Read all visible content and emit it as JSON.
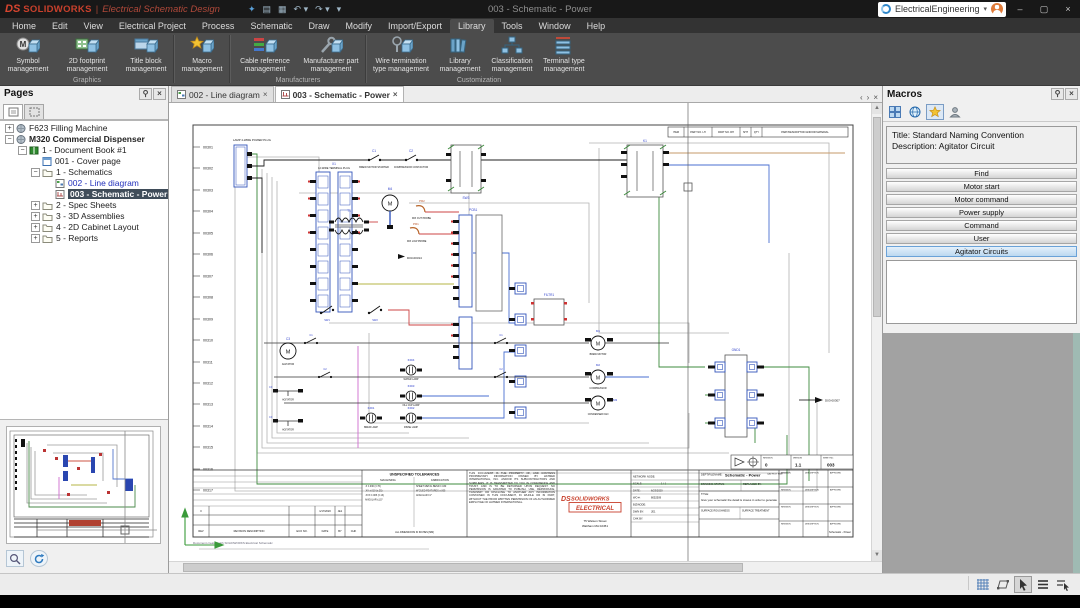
{
  "ui": {
    "close": "×",
    "pin": "⚲",
    "caret": "▾",
    "prev": "‹",
    "next": "›",
    "minimize": "–",
    "maximize": "▢",
    "collapsed": "+",
    "expanded": "−"
  },
  "titlebar": {
    "logo_ds": "DS",
    "brand": "SOLIDWORKS",
    "divider": "|",
    "app_title": "Electrical Schematic Design",
    "doc_title": "003 - Schematic - Power",
    "account": "ElectricalEngineering"
  },
  "menubar": {
    "items": [
      "Home",
      "Edit",
      "View",
      "Electrical Project",
      "Process",
      "Schematic",
      "Draw",
      "Modify",
      "Import/Export",
      "Library",
      "Tools",
      "Window",
      "Help"
    ]
  },
  "ribbon": {
    "groups": [
      {
        "label": "Graphics",
        "items": [
          "Symbol management",
          "2D footprint management",
          "Title block management"
        ]
      },
      {
        "label": "",
        "items": [
          "Macro management"
        ]
      },
      {
        "label": "Manufacturers",
        "items": [
          "Cable reference management",
          "Manufacturer part management"
        ]
      },
      {
        "label": "Customization",
        "items": [
          "Wire termination type management",
          "Library management",
          "Classification management",
          "Terminal type management"
        ]
      }
    ]
  },
  "pages_panel": {
    "title": "Pages",
    "tree": [
      {
        "label": "F623 Filling Machine"
      },
      {
        "label": "M320 Commercial Dispenser"
      },
      {
        "label": "1 - Document Book #1"
      },
      {
        "label": "001 - Cover page"
      },
      {
        "label": "1 - Schematics"
      },
      {
        "label": "002 - Line diagram"
      },
      {
        "label": "003 - Schematic - Power"
      },
      {
        "label": "2 - Spec Sheets"
      },
      {
        "label": "3 - 3D Assemblies"
      },
      {
        "label": "4 - 2D Cabinet Layout"
      },
      {
        "label": "5 - Reports"
      }
    ]
  },
  "doc_tabs": {
    "tabs": [
      "002 - Line diagram",
      "003 - Schematic - Power"
    ]
  },
  "macros_panel": {
    "title": "Macros",
    "info_line1": "Title: Standard Naming Convention",
    "info_line2": "Description: Agitator Circuit",
    "groups": [
      "Find",
      "Motor start",
      "Motor command",
      "Power supply",
      "Command",
      "User",
      "Agitator Circuits"
    ]
  },
  "schematic": {
    "wire_numbers": [
      "00301",
      "00302",
      "00303",
      "00304",
      "00305",
      "00306",
      "00307",
      "00308",
      "00309",
      "00310",
      "00311",
      "00312",
      "00313",
      "00314",
      "00315",
      "00316",
      "00317"
    ],
    "bom_columns": [
      "ITEM",
      "PART NO. LH",
      "PART NO. RH",
      "SHT",
      "QTY",
      "PART/DESCRIPTION AND/OR MATERIAL"
    ],
    "components": {
      "j1_desc": "LAMP 4-WIRE POWER PLUG",
      "x1_label": "X1",
      "x1_desc": "12-WIRE TERMINAL PLUG",
      "c1_label": "C1",
      "c1_desc": "BREW MOTOR STARTER",
      "c2_label": "C2",
      "c2_desc": "COMPRESSOR CONTACTOR",
      "sw1_label": "SW1",
      "sw1_desc": "SWITCH",
      "sw2_label": "SW2",
      "sw2_desc": "SWITCH",
      "sw3_label": "SW3",
      "k1_label": "K1",
      "t1_label": "T1",
      "m4_label": "M4",
      "m1_label": "M1",
      "m1_desc": "BREW MOTOR",
      "m2_label": "M2",
      "m2_desc": "COMPRESSOR",
      "m3_label": "M3",
      "m3_desc": "CONDENSER FAN",
      "c3_label": "C3",
      "c3_desc": "AGITATOR",
      "pr1_label": "PR1",
      "pr1_desc": "MIX LOW PROBE",
      "pr2_label": "PR2",
      "pr2_desc": "MIX OUT PROBE",
      "pcb1_label": "PCB1",
      "filtr1_label": "FILTR1",
      "gnd1_label": "GND1",
      "ind1_label": "IND1",
      "ind1_desc": "BREW LAMP",
      "ind2_label": "IND2",
      "ind2_desc": "RINSE LAMP",
      "ind3_label": "IND3",
      "ind3_desc": "FILL CUP LAMP",
      "ind4_label": "IND4",
      "ind4_desc": "WATER LAMP",
      "motor_letter": "M",
      "xref1": "D03-00307",
      "xref2": "D03-00314"
    }
  },
  "title_block": {
    "tolerances_title": "UNSPECIFIED TOLERANCES",
    "col_machining": "MACHINING",
    "col_fabrication": "FABRICATION",
    "tol_lines": [
      ".X  ±.030 (±.76)",
      ".XX  ±.010 (±.25)",
      ".XXX  ±.005 (±.13)",
      "ANGULAR  ±1/2°"
    ],
    "fab_lines": [
      "SHEET METAL BEND ±.030",
      "W'CUED FEATURES ±.005",
      "ANGULAR ±1°"
    ],
    "tol_note": "ALL DIMENSIONS IN INCHES [MM]",
    "legal": "THIS DOCUMENT IS THE PROPERTY OF, AND CONTAINS PROPRIETARY INFORMATION OWNED BY HATMED INTERNATIONAL, INC. AND/OR ITS SUBCONTRACTORS AND SUPPLIERS. IT IS TRANSMITTED TO YOU IN CONFIDENCE AND TRUST, AND IS TO BE RETURNED UPON REQUEST. NO PERMISSION IS GRANTED TO PUBLISH, USE, REPRODUCE, TRANSMIT OR DISCLOSE TO ANOTHER ANY INFORMATION CONTAINED IN THIS DOCUMENT, IN WHOLE OR IN PART, WITHOUT THE PRIOR WRITTEN PERMISSION OF AN AUTHORIZED EMPLOYEE OF HATMED INTERNATIONAL.",
    "logo_ds": "DS",
    "logo_brand": "SOLIDWORKS",
    "logo_sub": "ELECTRICAL",
    "address1": "75 Watson Street",
    "address2": "Waltham MA 02451",
    "f_network": "NETWORK NODE:",
    "f_scale": "SCALE:",
    "v_scale": "1 / 1",
    "f_date": "DATE:",
    "v_date": "6/23/2020",
    "f_wo": "WO #:",
    "v_wo": "8052509",
    "f_biz": "BIZ/NODE:",
    "f_dwn": "DWN BY:",
    "v_dwn": "JE1",
    "f_chk": "CHK BY:",
    "f_dept": "DEPT/FILENAME:",
    "v_dept": "Schematic - Power",
    "f_cad": "CAD PLOT SIZE",
    "f_status": "DRAWING STATUS:",
    "f_replaced": "REPLACED BY:",
    "f_title": "TITLE:",
    "v_title": "Give your schematic the detail is craves in order to generate",
    "f_rough": "SURFACE ROUGHNESS",
    "f_treat": "SURFACE TREATMENT",
    "rev_headers": [
      "REVISION",
      "DESCRIPTION",
      "APPROVED"
    ],
    "proj_rev_h": "REVISION",
    "proj_ver_h": "VERSION",
    "proj_sheet_h": "SHEET NO.",
    "proj_rev": "0",
    "proj_ver": "1.1",
    "proj_sheet": "003",
    "corner_label": "Schematic - Power",
    "footer_cells": [
      "REV",
      "REVISION DESCRIPTION",
      "ECO NO.",
      "DATE",
      "BY",
      "CHK"
    ],
    "rev_row_rev": "0",
    "rev_row_date": "1/17/2020",
    "rev_row_by": "JE1",
    "footnote": "Document created with SOLIDWORKS Electrical Schematic"
  },
  "status_bar": {
    "icons": [
      "grid-icon",
      "polygon-icon",
      "cursor-icon",
      "lines-icon",
      "selection-icon"
    ]
  },
  "colors": {
    "brand_red": "#d9452f",
    "wire_green": "#3d8b3d",
    "wire_blue": "#4a6fd0",
    "wire_red": "#cc4444",
    "wire_orange": "#c59a6a",
    "wire_magenta": "#cf6ccf",
    "wire_yellow": "#b4b446",
    "selection_blue": "#bcd8f0"
  }
}
